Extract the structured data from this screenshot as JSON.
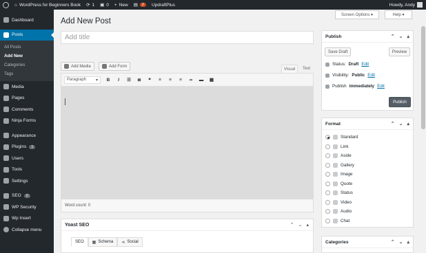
{
  "admin_bar": {
    "site_name": "WordPress for Beginners Book",
    "updates_count": "1",
    "comments_count": "0",
    "new_label": "New",
    "plugin_badge": "2",
    "updraft_label": "UpdraftPlus",
    "greeting": "Howdy, Andy"
  },
  "sidebar": {
    "dashboard": "Dashboard",
    "posts": "Posts",
    "posts_sub": [
      "All Posts",
      "Add New",
      "Categories",
      "Tags"
    ],
    "media": "Media",
    "pages": "Pages",
    "comments": "Comments",
    "ninja_forms": "Ninja Forms",
    "appearance": "Appearance",
    "plugins": "Plugins",
    "plugins_count": "1",
    "users": "Users",
    "tools": "Tools",
    "settings": "Settings",
    "seo": "SEO",
    "seo_count": "2",
    "wp_security": "WP Security",
    "wp_insert": "Wp Insert",
    "collapse": "Collapse menu"
  },
  "header": {
    "screen_options": "Screen Options ▾",
    "help": "Help ▾",
    "page_title": "Add New Post"
  },
  "editor": {
    "title_placeholder": "Add title",
    "add_media": "Add Media",
    "add_form": "Add Form",
    "tab_visual": "Visual",
    "tab_text": "Text",
    "paragraph_select": "Paragraph",
    "word_count": "Word count: 0"
  },
  "yoast": {
    "title": "Yoast SEO",
    "tab_seo": "SEO",
    "tab_schema": "Schema",
    "tab_social": "Social"
  },
  "publish": {
    "title": "Publish",
    "save_draft": "Save Draft",
    "preview": "Preview",
    "status_label": "Status:",
    "status_value": "Draft",
    "visibility_label": "Visibility:",
    "visibility_value": "Public",
    "publish_label": "Publish",
    "publish_value": "immediately",
    "edit": "Edit",
    "publish_button": "Publish"
  },
  "format": {
    "title": "Format",
    "options": [
      "Standard",
      "Link",
      "Aside",
      "Gallery",
      "Image",
      "Quote",
      "Status",
      "Video",
      "Audio",
      "Chat"
    ]
  },
  "categories": {
    "title": "Categories"
  },
  "colors": {
    "admin_bar": "#23282d",
    "accent": "#0073aa",
    "publish_button": "#555d66"
  }
}
